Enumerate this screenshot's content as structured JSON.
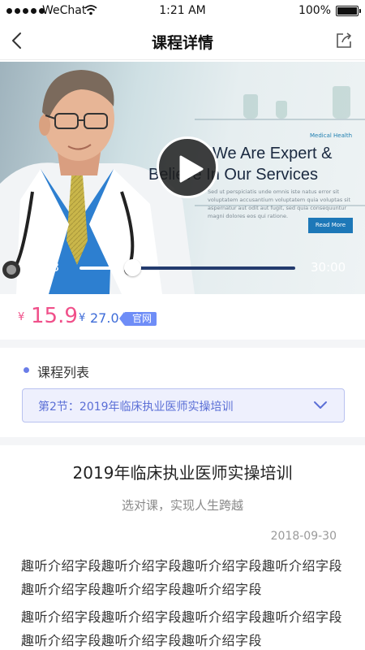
{
  "status_bar": {
    "carrier": "WeChat",
    "time": "1:21 AM",
    "battery": "100%"
  },
  "nav": {
    "title": "课程详情",
    "back_icon": "chevron-left-icon",
    "share_icon": "share-icon"
  },
  "video": {
    "current_time": "07:23",
    "total_time": "30:00",
    "progress": 0.246,
    "poster": {
      "eyebrow": "Medical Health",
      "headline_1": "We Are Expert &",
      "headline_2": "Believe In Our Services",
      "body": "Sed ut perspiciatis unde omnis iste natus error sit voluptatem accusantium voluptatem quia voluptas sit aspernatur aut odit aut fugit, sed quia consequuntur magni dolores eos qui ratione.",
      "button": "Read More"
    }
  },
  "price": {
    "currency": "¥",
    "current": "15.9",
    "original": "27.0",
    "tag": "官网",
    "accent_color": "#f0508a",
    "original_color": "#3e6cd8"
  },
  "course_list": {
    "heading": "课程列表",
    "selected_chapter": "第2节：2019年临床执业医师实操培训"
  },
  "detail": {
    "title": "2019年临床执业医师实操培训",
    "subtitle": "选对课，实现人生跨越",
    "date": "2018-09-30",
    "paragraphs": [
      "趣听介绍字段趣听介绍字段趣听介绍字段趣听介绍字段趣听介绍字段趣听介绍字段趣听介绍字段",
      "趣听介绍字段趣听介绍字段趣听介绍字段趣听介绍字段趣听介绍字段趣听介绍字段趣听介绍字段"
    ]
  }
}
